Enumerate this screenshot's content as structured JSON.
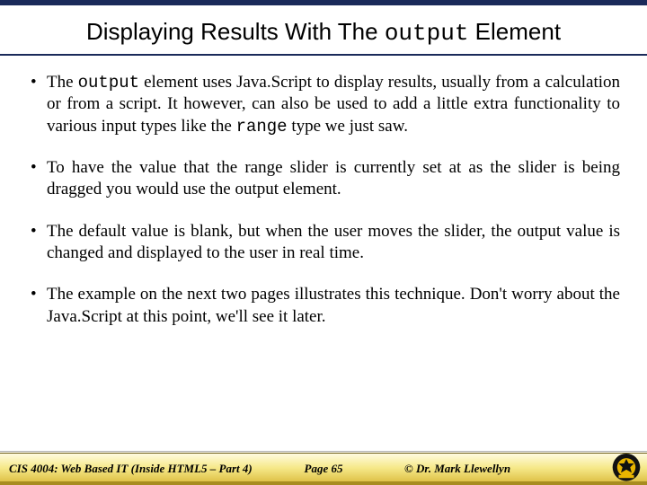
{
  "title": {
    "prefix": "Displaying Results With The ",
    "code": "output",
    "suffix": " Element"
  },
  "bullets": [
    {
      "html": "The <span class=\"mono\">output</span> element uses Java.Script to display results, usually from a calculation or from a script.  It however, can also be used to add a little extra functionality to various input types like the <span class=\"mono\">range</span> type we just saw."
    },
    {
      "html": "To have the value that the range slider is currently set at as the slider is being dragged you would use the output element."
    },
    {
      "html": "The default value is blank, but when the user moves the slider, the output value is changed and displayed to the user in real time."
    },
    {
      "html": "The example on the next two pages illustrates this technique.  Don't worry about the Java.Script at this point, we'll see it later."
    }
  ],
  "footer": {
    "course": "CIS 4004: Web Based IT (Inside HTML5 – Part 4)",
    "page": "Page 65",
    "author": "© Dr. Mark Llewellyn"
  }
}
